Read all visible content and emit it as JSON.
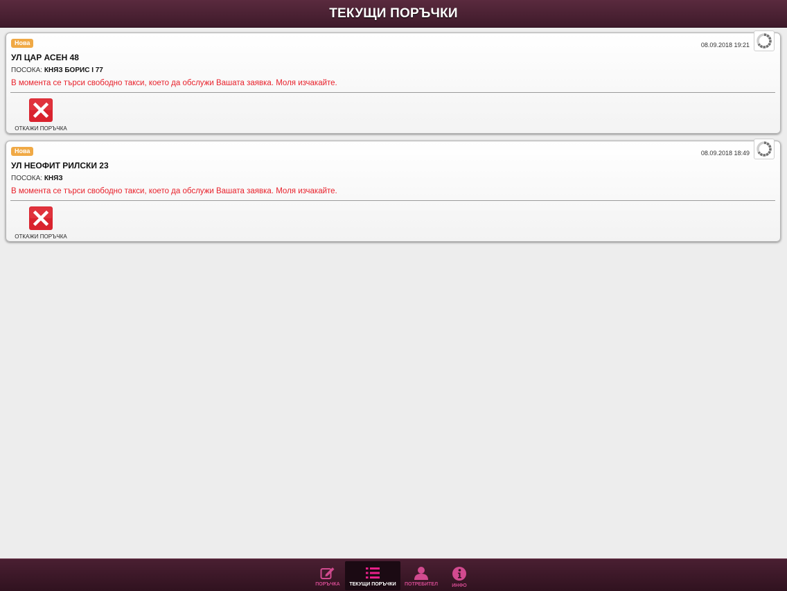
{
  "header": {
    "title": "ТЕКУЩИ ПОРЪЧКИ"
  },
  "orders": [
    {
      "badge": "Нова",
      "datetime": "08.09.2018 19:21",
      "address": "УЛ ЦАР АСЕН 48",
      "direction_label": "ПОСОКА:",
      "direction_value": "КНЯЗ БОРИС I 77",
      "status": "В момента се търси свободно такси, което да обслужи Вашата заявка. Моля изчакайте.",
      "cancel_label": "ОТКАЖИ ПОРЪЧКА"
    },
    {
      "badge": "Нова",
      "datetime": "08.09.2018 18:49",
      "address": "УЛ НЕОФИТ РИЛСКИ 23",
      "direction_label": "ПОСОКА:",
      "direction_value": "КНЯЗ",
      "status": "В момента се търси свободно такси, което да обслужи Вашата заявка. Моля изчакайте.",
      "cancel_label": "ОТКАЖИ ПОРЪЧКА"
    }
  ],
  "tabbar": {
    "tabs": [
      {
        "label": "ПОРЪЧКА",
        "icon": "edit-icon",
        "active": false
      },
      {
        "label": "ТЕКУЩИ ПОРЪЧКИ",
        "icon": "list-icon",
        "active": true
      },
      {
        "label": "ПОТРЕБИТЕЛ",
        "icon": "user-icon",
        "active": false
      },
      {
        "label": "ИНФО",
        "icon": "info-icon",
        "active": false
      }
    ]
  },
  "colors": {
    "header_bg": "#4d2235",
    "badge": "#f0a945",
    "status_text": "#e8202a",
    "cancel_red": "#d9232e",
    "tab_inactive": "#d14a8f",
    "tab_active_icon": "#e8208a",
    "tab_active_text": "#ffffff"
  }
}
